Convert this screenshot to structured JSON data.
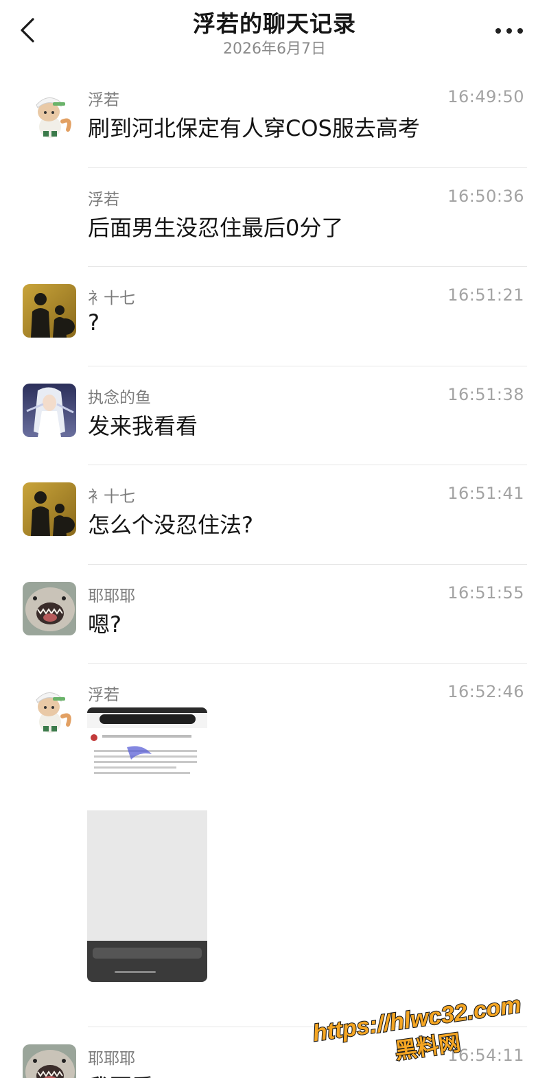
{
  "header": {
    "title": "浮若的聊天记录",
    "date": "2026年6月7日"
  },
  "messages": [
    {
      "sender": "浮若",
      "time": "16:49:50",
      "text": "刷到河北保定有人穿COS服去高考",
      "avatar": "fox-mascot"
    },
    {
      "sender": "浮若",
      "time": "16:50:36",
      "text": "后面男生没忍住最后0分了",
      "avatar": "none"
    },
    {
      "sender": "衤十七",
      "time": "16:51:21",
      "text": "?",
      "avatar": "silhouette-gold"
    },
    {
      "sender": "执念的鱼",
      "time": "16:51:38",
      "text": "发来我看看",
      "avatar": "anime-white-hair"
    },
    {
      "sender": "衤十七",
      "time": "16:51:41",
      "text": "怎么个没忍住法?",
      "avatar": "silhouette-gold"
    },
    {
      "sender": "耶耶耶",
      "time": "16:51:55",
      "text": "嗯?",
      "avatar": "shark-mouth"
    },
    {
      "sender": "浮若",
      "time": "16:52:46",
      "text": "",
      "avatar": "fox-mascot",
      "image": "blurred-phone-screenshot"
    },
    {
      "sender": "耶耶耶",
      "time": "16:54:11",
      "text": "我要看cos",
      "avatar": "shark-mouth"
    }
  ],
  "watermark": {
    "line1": "https://hlwc32.com",
    "line2": "黑料网"
  },
  "colors": {
    "time": "#a3a3a3",
    "sender": "#7b7b7b",
    "divider": "#e6e6e6",
    "watermark_fill": "#f5a623",
    "watermark_stroke": "#1a1a1a"
  }
}
